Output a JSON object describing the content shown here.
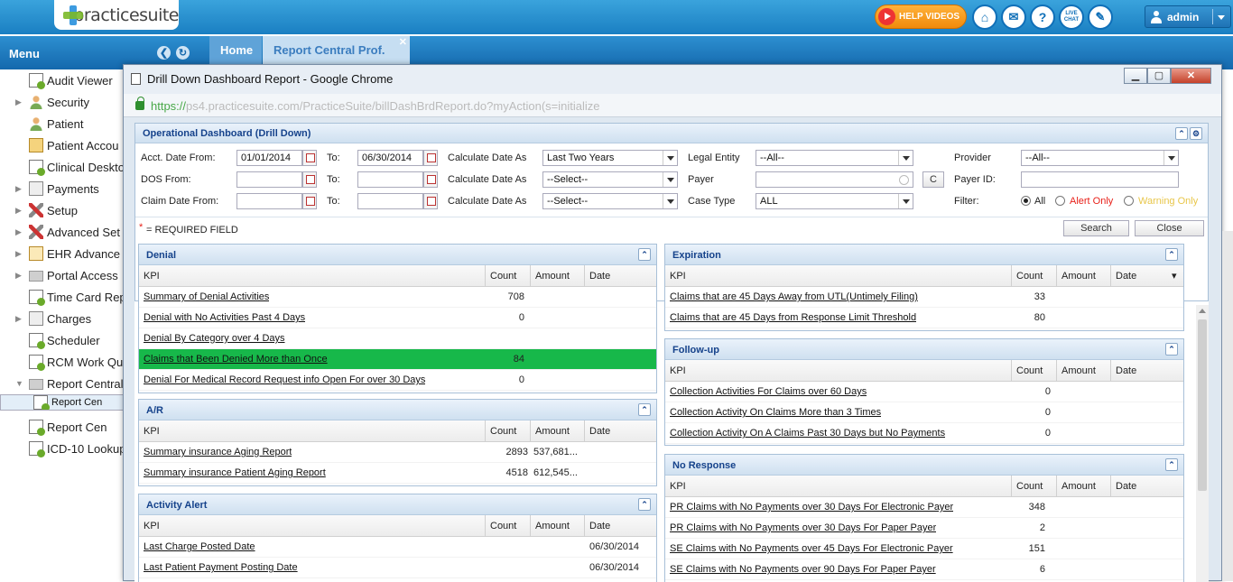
{
  "app": {
    "logo_text": "practicesuite"
  },
  "topbar": {
    "help_videos": "HELP VIDEOS",
    "live_chat": "LIVE CHAT",
    "user": "admin"
  },
  "menu": {
    "title": "Menu",
    "items": [
      {
        "label": "Audit Viewer"
      },
      {
        "label": "Security"
      },
      {
        "label": "Patient"
      },
      {
        "label": "Patient Accou"
      },
      {
        "label": "Clinical Deskto"
      },
      {
        "label": "Payments"
      },
      {
        "label": "Setup"
      },
      {
        "label": "Advanced Set"
      },
      {
        "label": "EHR Advance"
      },
      {
        "label": "Portal Access"
      },
      {
        "label": "Time Card Rep"
      },
      {
        "label": "Charges"
      },
      {
        "label": "Scheduler"
      },
      {
        "label": "RCM Work Qu"
      },
      {
        "label": "Report Central"
      },
      {
        "label": "Report Cen"
      },
      {
        "label": "Report Cen"
      },
      {
        "label": "ICD-10 Lookup"
      }
    ]
  },
  "tabs": [
    {
      "label": "Home"
    },
    {
      "label": "Report Central Prof."
    }
  ],
  "window": {
    "title": "Drill Down Dashboard Report - Google Chrome",
    "url_https": "https://",
    "url_rest": "ps4.practicesuite.com/PracticeSuite/billDashBrdReport.do?myAction(s=initialize"
  },
  "filters": {
    "title": "Operational Dashboard (Drill Down)",
    "acct_date_from_label": "Acct. Date From:",
    "acct_date_from": "01/01/2014",
    "to_label": "To:",
    "acct_date_to": "06/30/2014",
    "dos_from_label": "DOS From:",
    "claim_date_from_label": "Claim Date From:",
    "calc_date_as_label": "Calculate Date As",
    "calc1": "Last Two Years",
    "calc2": "--Select--",
    "calc3": "--Select--",
    "legal_entity_label": "Legal Entity",
    "legal_entity": "--All--",
    "payer_label": "Payer",
    "payer_btn": "C",
    "case_type_label": "Case Type",
    "case_type": "ALL",
    "provider_label": "Provider",
    "provider": "--All--",
    "payer_id_label": "Payer ID:",
    "filter_label": "Filter:",
    "filter_all": "All",
    "filter_alert": "Alert Only",
    "filter_warning": "Warning Only",
    "required_star": "*",
    "required_text": "= REQUIRED FIELD",
    "search_btn": "Search",
    "close_btn": "Close"
  },
  "colors": {
    "alert": "#e8211a",
    "warning": "#e8c64a",
    "highlight": "#17b84a"
  },
  "panels": {
    "denial": {
      "title": "Denial",
      "headers": [
        "KPI",
        "Count",
        "Amount",
        "Date"
      ],
      "rows": [
        {
          "kpi": "Summary of Denial Activities",
          "count": "708",
          "amount": "",
          "date": ""
        },
        {
          "kpi": "Denial with No Activities Past 4 Days",
          "count": "0",
          "amount": "",
          "date": ""
        },
        {
          "kpi": "Denial By Category over 4 Days",
          "count": "",
          "amount": "",
          "date": ""
        },
        {
          "kpi": "Claims that Been Denied More than Once",
          "count": "84",
          "amount": "",
          "date": ""
        },
        {
          "kpi": "Denial For Medical Record Request info Open For over 30 Days",
          "count": "0",
          "amount": "",
          "date": ""
        }
      ]
    },
    "ar": {
      "title": "A/R",
      "headers": [
        "KPI",
        "Count",
        "Amount",
        "Date"
      ],
      "rows": [
        {
          "kpi": "Summary insurance Aging Report",
          "count": "2893",
          "amount": "537,681...",
          "date": ""
        },
        {
          "kpi": "Summary insurance Patient Aging Report",
          "count": "4518",
          "amount": "612,545...",
          "date": ""
        }
      ]
    },
    "activity": {
      "title": "Activity Alert",
      "headers": [
        "KPI",
        "Count",
        "Amount",
        "Date"
      ],
      "rows": [
        {
          "kpi": "Last Charge Posted Date",
          "count": "",
          "amount": "",
          "date": "06/30/2014"
        },
        {
          "kpi": "Last Patient Payment Posting Date",
          "count": "",
          "amount": "",
          "date": "06/30/2014"
        }
      ]
    },
    "expiration": {
      "title": "Expiration",
      "headers": [
        "KPI",
        "Count",
        "Amount",
        "Date"
      ],
      "rows": [
        {
          "kpi": "Claims that are 45 Days Away from UTL(Untimely Filing)",
          "count": "33",
          "amount": "",
          "date": ""
        },
        {
          "kpi": "Claims that are 45 Days from Response Limit Threshold",
          "count": "80",
          "amount": "",
          "date": ""
        }
      ]
    },
    "followup": {
      "title": "Follow-up",
      "headers": [
        "KPI",
        "Count",
        "Amount",
        "Date"
      ],
      "rows": [
        {
          "kpi": "Collection Activities For Claims over 60 Days",
          "count": "0",
          "amount": "",
          "date": ""
        },
        {
          "kpi": "Collection Activity On Claims More than 3 Times",
          "count": "0",
          "amount": "",
          "date": ""
        },
        {
          "kpi": "Collection Activity On A Claims Past 30 Days but No Payments",
          "count": "0",
          "amount": "",
          "date": ""
        }
      ]
    },
    "noresponse": {
      "title": "No Response",
      "headers": [
        "KPI",
        "Count",
        "Amount",
        "Date"
      ],
      "rows": [
        {
          "kpi": "PR Claims with No Payments over 30 Days For Electronic Payer",
          "count": "348",
          "amount": "",
          "date": ""
        },
        {
          "kpi": "PR Claims with No Payments over 30 Days For Paper Payer",
          "count": "2",
          "amount": "",
          "date": ""
        },
        {
          "kpi": "SE Claims with No Payments over 45 Days For Electronic Payer",
          "count": "151",
          "amount": "",
          "date": ""
        },
        {
          "kpi": "SE Claims with No Payments over 90 Days For Paper Payer",
          "count": "6",
          "amount": "",
          "date": ""
        }
      ]
    }
  }
}
